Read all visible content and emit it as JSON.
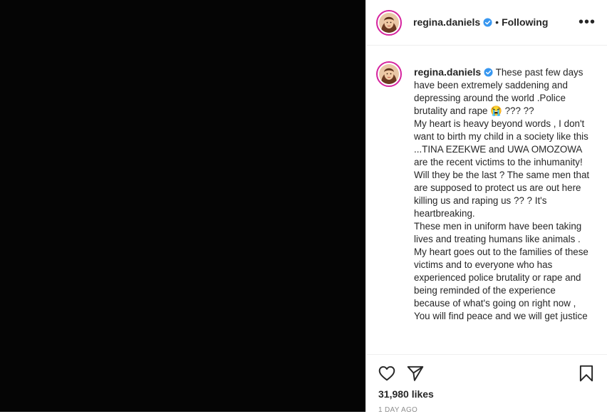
{
  "post": {
    "username": "regina.daniels",
    "separator": "•",
    "follow_state": "Following",
    "more_label": "•••"
  },
  "caption": {
    "username": "regina.daniels",
    "paragraphs": [
      "These past few days have been extremely saddening and depressing around the world .Police brutality and rape 😭 ??? ??",
      "My heart is heavy beyond words , I don't want to birth my child in a society like this ...TINA EZEKWE and UWA OMOZOWA are the recent victims to the inhumanity! Will they be the last ? The same men that are supposed to protect us are out here killing us and raping us ?? ? It's heartbreaking.",
      "These men in uniform have been taking lives and treating humans like animals .",
      "My heart goes out to the families of these victims and to everyone who has experienced police brutality or rape and being reminded of the experience because of what's going on right now , You will find peace and we will get justice"
    ]
  },
  "stats": {
    "likes": "31,980 likes",
    "time_ago": "1 DAY AGO"
  },
  "icons": {
    "like": "heart-icon",
    "share": "paper-plane-icon",
    "save": "bookmark-icon",
    "verified": "verified-badge-icon"
  },
  "colors": {
    "verified_blue": "#3897f0",
    "text": "#262626",
    "muted": "#8e8e8e",
    "story_ring": "#d6249f"
  }
}
